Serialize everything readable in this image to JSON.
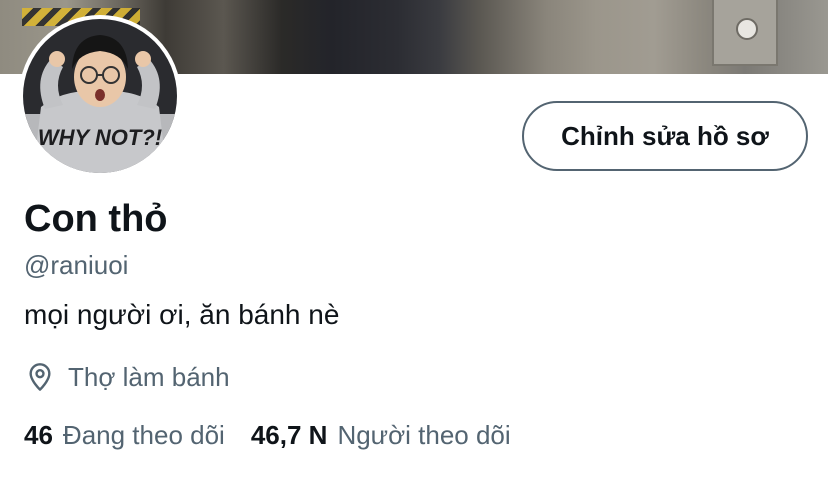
{
  "profile": {
    "display_name": "Con thỏ",
    "handle": "@raniuoi",
    "bio": "mọi người ơi, ăn bánh nè",
    "location": "Thợ làm bánh",
    "edit_button_label": "Chỉnh sửa hồ sơ",
    "avatar_text": "WHY NOT?!"
  },
  "stats": {
    "following_count": "46",
    "following_label": "Đang theo dõi",
    "followers_count": "46,7 N",
    "followers_label": "Người theo dõi"
  },
  "icons": {
    "location": "location-pin-icon"
  },
  "colors": {
    "text_primary": "#0f1419",
    "text_secondary": "#536471",
    "button_border": "#536471",
    "background": "#ffffff"
  }
}
